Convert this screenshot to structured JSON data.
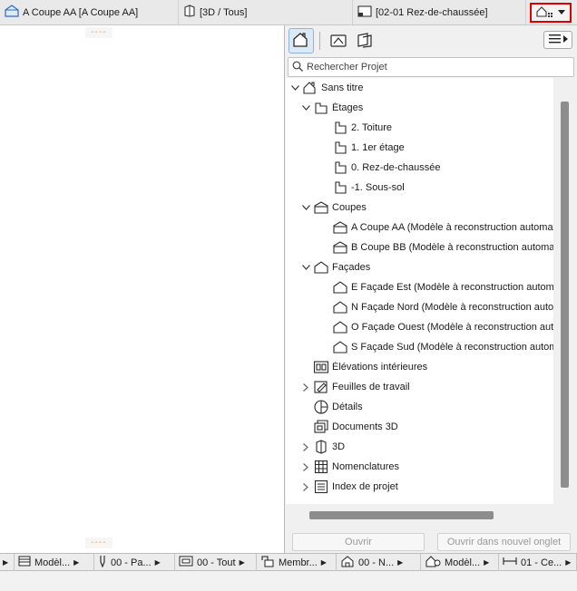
{
  "tabs": [
    {
      "label": "A Coupe AA [A Coupe AA]",
      "icon": "section-view-icon"
    },
    {
      "label": "[3D / Tous]",
      "icon": "3d-window-icon"
    },
    {
      "label": "[02-01 Rez-de-chaussée]",
      "icon": "floor-plan-icon"
    }
  ],
  "canvas": {
    "marker": "----"
  },
  "navigator": {
    "modes": [
      "project-map-icon",
      "view-map-icon",
      "layout-book-icon"
    ],
    "active_mode": "project-map-icon",
    "search_placeholder": "Rechercher Projet",
    "tree": [
      {
        "label": "Sans titre",
        "icon": "project-root-icon",
        "level": 0,
        "expander": "open"
      },
      {
        "label": "Étages",
        "icon": "stories-folder-icon",
        "level": 1,
        "expander": "open"
      },
      {
        "label": "2. Toiture",
        "icon": "story-icon",
        "level": 2,
        "expander": "none"
      },
      {
        "label": "1. 1er étage",
        "icon": "story-icon",
        "level": 2,
        "expander": "none"
      },
      {
        "label": "0. Rez-de-chaussée",
        "icon": "story-icon",
        "level": 2,
        "expander": "none"
      },
      {
        "label": "-1. Sous-sol",
        "icon": "story-icon",
        "level": 2,
        "expander": "none"
      },
      {
        "label": "Coupes",
        "icon": "sections-folder-icon",
        "level": 1,
        "expander": "open"
      },
      {
        "label": "A Coupe AA (Modèle à reconstruction automatique)",
        "icon": "section-icon",
        "level": 2,
        "expander": "none"
      },
      {
        "label": "B Coupe BB (Modèle à reconstruction automatique)",
        "icon": "section-icon",
        "level": 2,
        "expander": "none"
      },
      {
        "label": "Façades",
        "icon": "elevations-folder-icon",
        "level": 1,
        "expander": "open"
      },
      {
        "label": "E Façade Est (Modèle à reconstruction automatique)",
        "icon": "elevation-icon",
        "level": 2,
        "expander": "none"
      },
      {
        "label": "N Façade Nord (Modèle à reconstruction automatique)",
        "icon": "elevation-icon",
        "level": 2,
        "expander": "none"
      },
      {
        "label": "O Façade Ouest (Modèle à reconstruction automatique)",
        "icon": "elevation-icon",
        "level": 2,
        "expander": "none"
      },
      {
        "label": "S Façade Sud (Modèle à reconstruction automatique)",
        "icon": "elevation-icon",
        "level": 2,
        "expander": "none"
      },
      {
        "label": "Élévations intérieures",
        "icon": "interior-elevations-icon",
        "level": 1,
        "expander": "none"
      },
      {
        "label": "Feuilles de travail",
        "icon": "worksheets-icon",
        "level": 1,
        "expander": "closed"
      },
      {
        "label": "Détails",
        "icon": "details-icon",
        "level": 1,
        "expander": "none"
      },
      {
        "label": "Documents 3D",
        "icon": "documents-3d-icon",
        "level": 1,
        "expander": "none"
      },
      {
        "label": "3D",
        "icon": "3d-folder-icon",
        "level": 1,
        "expander": "closed"
      },
      {
        "label": "Nomenclatures",
        "icon": "schedules-icon",
        "level": 1,
        "expander": "closed"
      },
      {
        "label": "Index de projet",
        "icon": "project-indexes-icon",
        "level": 1,
        "expander": "closed"
      }
    ],
    "buttons": {
      "open": "Ouvrir",
      "open_new_tab": "Ouvrir dans nouvel onglet"
    }
  },
  "statusbar": [
    {
      "label": "Modèl...",
      "icon": "layer-combination-icon"
    },
    {
      "label": "00 - Pa...",
      "icon": "pen-set-icon"
    },
    {
      "label": "00 - Tout",
      "icon": "model-view-icon"
    },
    {
      "label": "Membr...",
      "icon": "override-icon"
    },
    {
      "label": "00 - N...",
      "icon": "renovation-icon"
    },
    {
      "label": "Modèl...",
      "icon": "structural-display-icon"
    },
    {
      "label": "01 - Ce...",
      "icon": "dimension-icon"
    }
  ]
}
